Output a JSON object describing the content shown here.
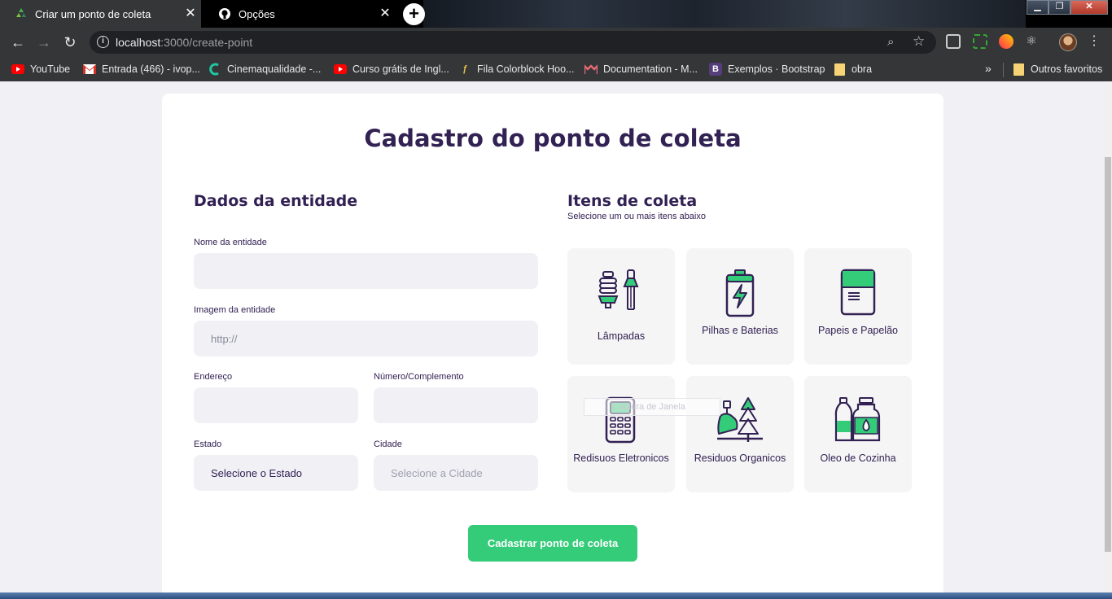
{
  "browser": {
    "tabs": [
      {
        "title": "Criar um ponto de coleta",
        "active": true,
        "icon": "recycle-icon"
      },
      {
        "title": "Opções",
        "active": false,
        "icon": "github-icon"
      }
    ],
    "url_host": "localhost",
    "url_path": ":3000/create-point",
    "bookmarks": [
      {
        "label": "YouTube",
        "icon": "youtube-icon"
      },
      {
        "label": "Entrada (466) - ivop...",
        "icon": "gmail-icon"
      },
      {
        "label": "Cinemaqualidade -...",
        "icon": "cinema-icon"
      },
      {
        "label": "Curso grátis de Ingl...",
        "icon": "youtube-icon"
      },
      {
        "label": "Fila Colorblock Hoo...",
        "icon": "brand-icon"
      },
      {
        "label": "Documentation - M...",
        "icon": "mui-icon"
      },
      {
        "label": "Exemplos · Bootstrap",
        "icon": "bootstrap-icon"
      },
      {
        "label": "obra",
        "icon": "folder-icon"
      }
    ],
    "other_bookmarks": "Outros favoritos"
  },
  "page": {
    "title": "Cadastro do ponto de coleta",
    "entity": {
      "heading": "Dados da entidade",
      "name_label": "Nome da entidade",
      "name_value": "",
      "image_label": "Imagem da entidade",
      "image_placeholder": "http://",
      "address_label": "Endereço",
      "address_value": "",
      "number_label": "Número/Complemento",
      "number_value": "",
      "state_label": "Estado",
      "state_value": "Selecione o Estado",
      "city_label": "Cidade",
      "city_placeholder": "Selecione a Cidade"
    },
    "items": {
      "heading": "Itens de coleta",
      "subheading": "Selecione um ou mais itens abaixo",
      "list": [
        {
          "label": "Lâmpadas",
          "icon": "lamps-icon"
        },
        {
          "label": "Pilhas e Baterias",
          "icon": "battery-icon"
        },
        {
          "label": "Papeis e Papelão",
          "icon": "paper-icon"
        },
        {
          "label": "Redisuos Eletronicos",
          "icon": "electronics-icon"
        },
        {
          "label": "Residuos Organicos",
          "icon": "organic-icon"
        },
        {
          "label": "Oleo de Cozinha",
          "icon": "oil-icon"
        }
      ]
    },
    "submit_label": "Cadastrar ponto de coleta",
    "overlay_text": "Captura de Janela"
  },
  "colors": {
    "primary": "#322153",
    "accent": "#34cb79",
    "background": "#f0f0f5"
  }
}
